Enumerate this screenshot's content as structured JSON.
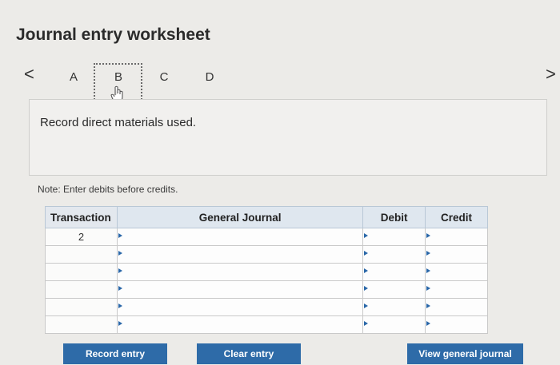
{
  "title": "Journal entry worksheet",
  "nav": {
    "prev": "<",
    "next": ">"
  },
  "tabs": [
    {
      "label": "A"
    },
    {
      "label": "B"
    },
    {
      "label": "C"
    },
    {
      "label": "D"
    }
  ],
  "instruction": "Record direct materials used.",
  "note": "Note: Enter debits before credits.",
  "table": {
    "headers": {
      "transaction": "Transaction",
      "general_journal": "General Journal",
      "debit": "Debit",
      "credit": "Credit"
    },
    "rows": [
      {
        "transaction": "2",
        "account": "",
        "debit": "",
        "credit": ""
      },
      {
        "transaction": "",
        "account": "",
        "debit": "",
        "credit": ""
      },
      {
        "transaction": "",
        "account": "",
        "debit": "",
        "credit": ""
      },
      {
        "transaction": "",
        "account": "",
        "debit": "",
        "credit": ""
      },
      {
        "transaction": "",
        "account": "",
        "debit": "",
        "credit": ""
      },
      {
        "transaction": "",
        "account": "",
        "debit": "",
        "credit": ""
      }
    ]
  },
  "buttons": {
    "record": "Record entry",
    "clear": "Clear entry",
    "view": "View general journal"
  },
  "colors": {
    "button": "#2e6ba8",
    "input_border": "#3b77b8"
  }
}
